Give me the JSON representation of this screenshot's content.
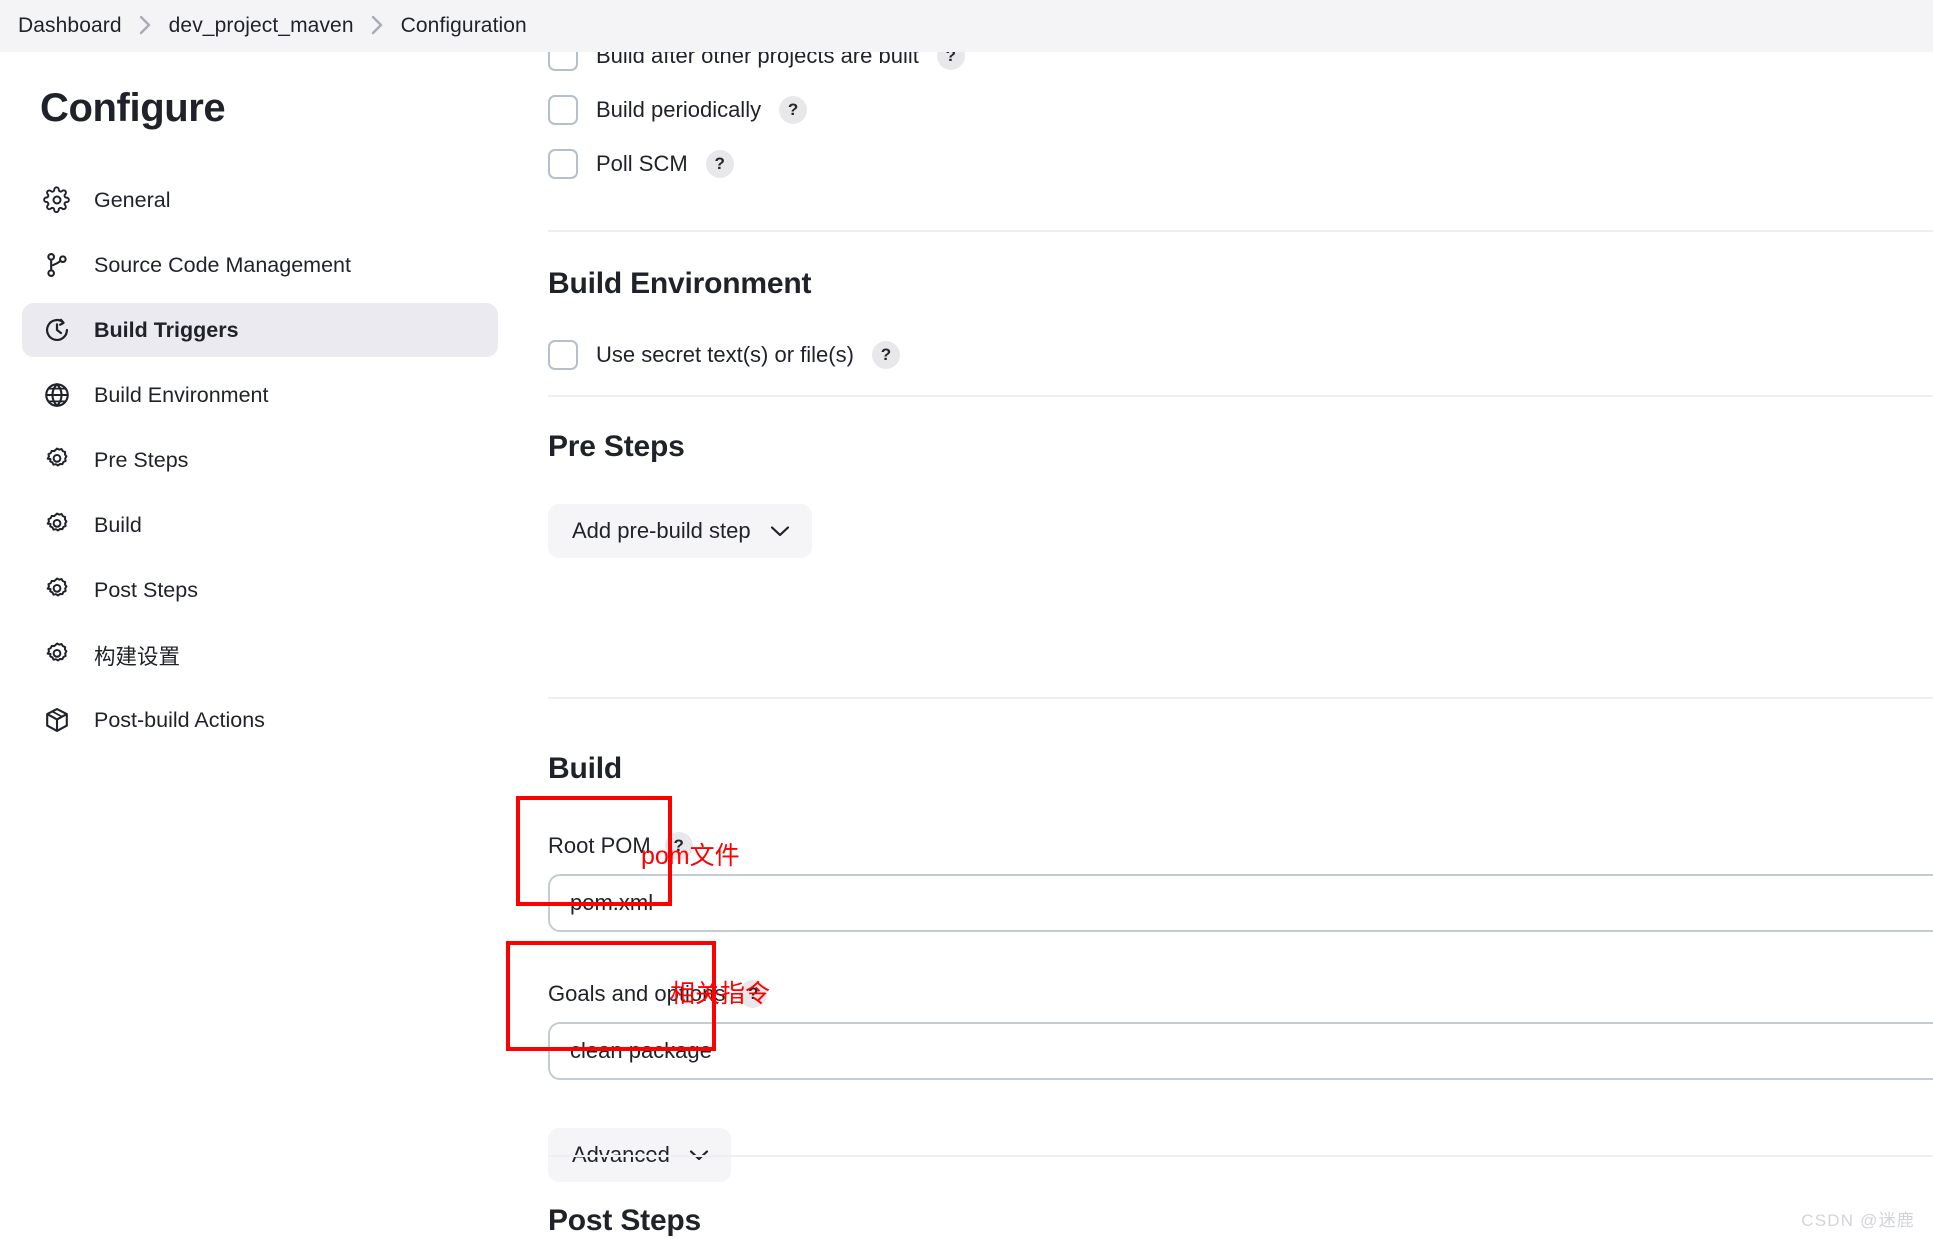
{
  "breadcrumb": {
    "items": [
      "Dashboard",
      "dev_project_maven",
      "Configuration"
    ]
  },
  "sidebar": {
    "title": "Configure",
    "items": [
      {
        "label": "General",
        "icon": "gear-icon",
        "active": false
      },
      {
        "label": "Source Code Management",
        "icon": "git-branch-icon",
        "active": false
      },
      {
        "label": "Build Triggers",
        "icon": "clock-icon",
        "active": true
      },
      {
        "label": "Build Environment",
        "icon": "globe-icon",
        "active": false
      },
      {
        "label": "Pre Steps",
        "icon": "gear-icon",
        "active": false
      },
      {
        "label": "Build",
        "icon": "gear-icon",
        "active": false
      },
      {
        "label": "Post Steps",
        "icon": "gear-icon",
        "active": false
      },
      {
        "label": "构建设置",
        "icon": "gear-icon",
        "active": false
      },
      {
        "label": "Post-build Actions",
        "icon": "package-icon",
        "active": false
      }
    ]
  },
  "triggers": {
    "checkboxes": [
      {
        "label": "Build after other projects are built",
        "checked": false,
        "help": "?"
      },
      {
        "label": "Build periodically",
        "checked": false,
        "help": "?"
      },
      {
        "label": "Poll SCM",
        "checked": false,
        "help": "?"
      }
    ]
  },
  "build_environment": {
    "heading": "Build Environment",
    "checkboxes": [
      {
        "label": "Use secret text(s) or file(s)",
        "checked": false,
        "help": "?"
      }
    ]
  },
  "pre_steps": {
    "heading": "Pre Steps",
    "add_button": "Add pre-build step"
  },
  "build": {
    "heading": "Build",
    "root_pom": {
      "label": "Root POM",
      "help": "?",
      "value": "pom.xml",
      "placeholder": "pom.xml"
    },
    "goals": {
      "label": "Goals and options",
      "help": "?",
      "value": "clean package",
      "placeholder": ""
    },
    "advanced_button": "Advanced"
  },
  "post_steps": {
    "heading": "Post Steps"
  },
  "annotations": {
    "color": "#ff0000",
    "notes": [
      {
        "text": "pom文件",
        "target": "root-pom-field"
      },
      {
        "text": "相关指令",
        "target": "goals-and-options-field"
      }
    ]
  },
  "watermark": "CSDN @迷鹿"
}
